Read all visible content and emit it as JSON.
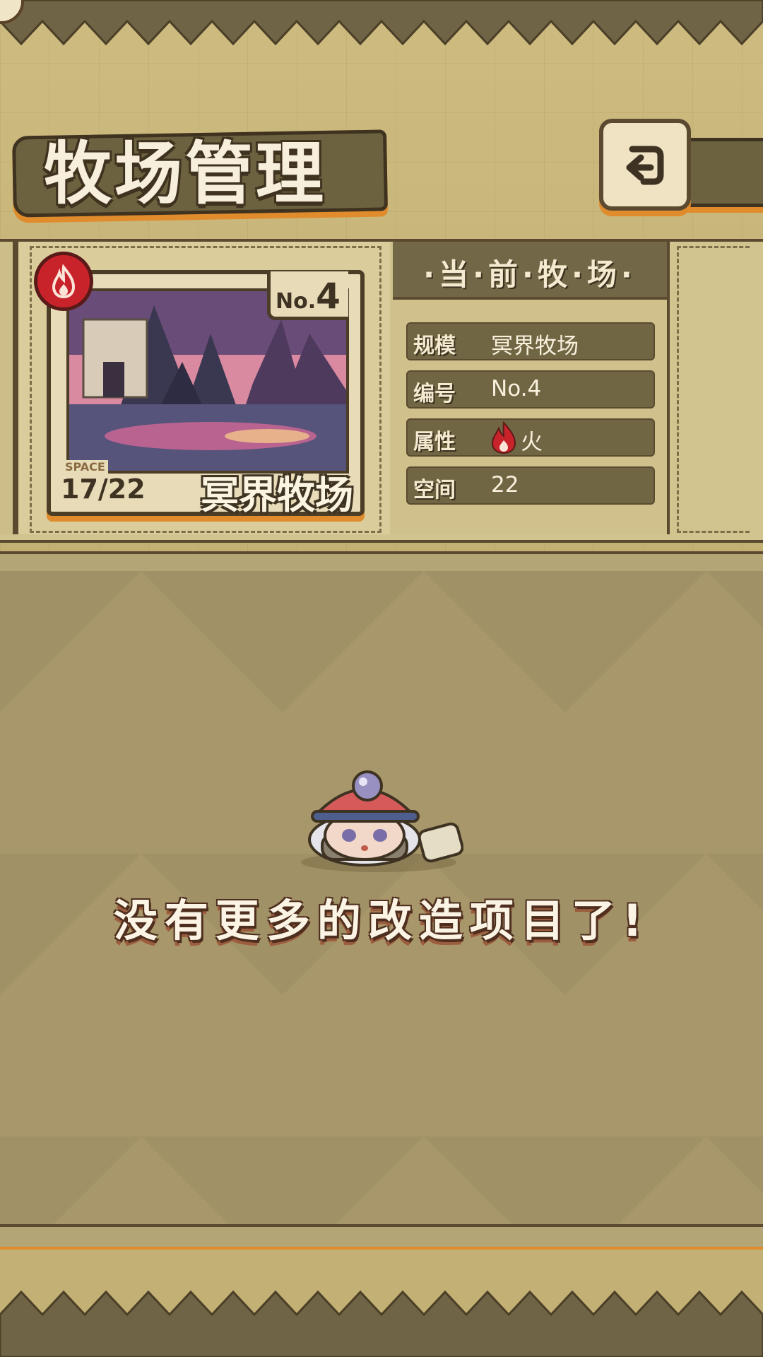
{
  "header": {
    "title": "牧场管理"
  },
  "farm_card": {
    "number_prefix": "No.",
    "number_value": "4",
    "space_label": "SPACE",
    "space_value": "17/22",
    "name": "冥界牧场",
    "element_icon": "fire-icon"
  },
  "current_panel": {
    "title": "·当·前·牧·场·",
    "rows": [
      {
        "key": "规模",
        "value": "冥界牧场"
      },
      {
        "key": "编号",
        "value": "No.4"
      },
      {
        "key": "属性",
        "value": "火"
      },
      {
        "key": "空间",
        "value": "22"
      }
    ]
  },
  "empty_state": {
    "message": "没有更多的改造项目了!"
  },
  "colors": {
    "accent_orange": "#e08b2c",
    "fire_red": "#c8232a",
    "panel_dark": "#716643"
  }
}
